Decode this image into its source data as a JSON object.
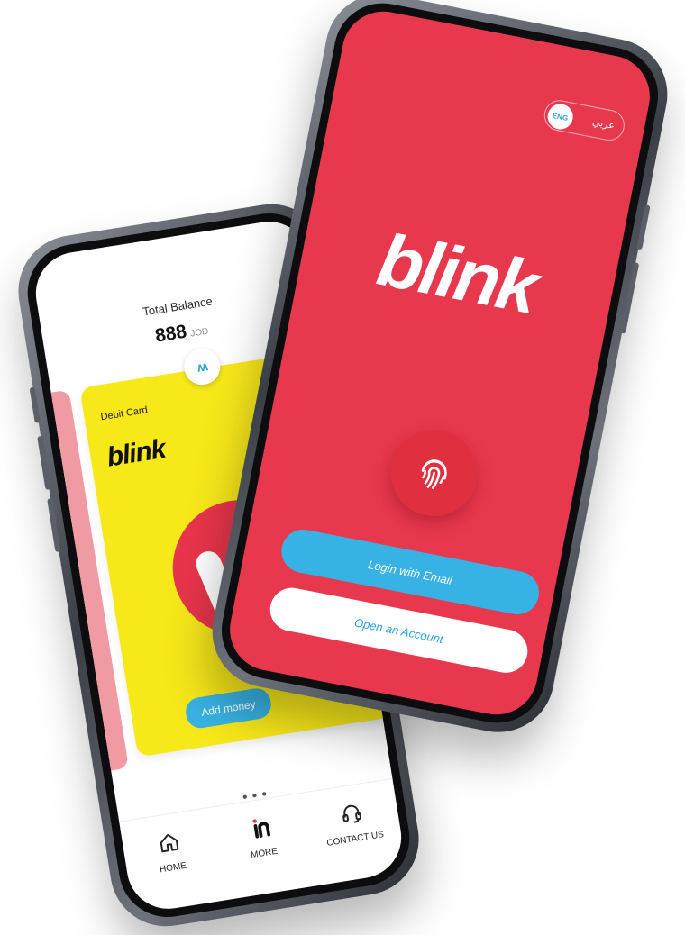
{
  "app": {
    "brand": "blink",
    "colors": {
      "primary_red": "#e8384d",
      "accent_blue": "#36b2e4",
      "card_yellow": "#f7e81a"
    }
  },
  "dashboard": {
    "total_balance_label": "Total Balance",
    "total_balance_value": "888",
    "currency": "JOD",
    "card": {
      "type_label": "Debit Card",
      "logo_text": "blink",
      "add_money_label": "Add money"
    },
    "nav": [
      {
        "label": "HOME",
        "icon": "home-icon"
      },
      {
        "label": "MORE",
        "icon": "blink-mark-icon"
      },
      {
        "label": "CONTACT US",
        "icon": "headset-icon"
      }
    ]
  },
  "login": {
    "lang_active": "ENG",
    "lang_alt": "عربي",
    "logo_text": "blink",
    "fingerprint_icon": "fingerprint-icon",
    "login_email_label": "Login with Email",
    "open_account_label": "Open an Account"
  }
}
